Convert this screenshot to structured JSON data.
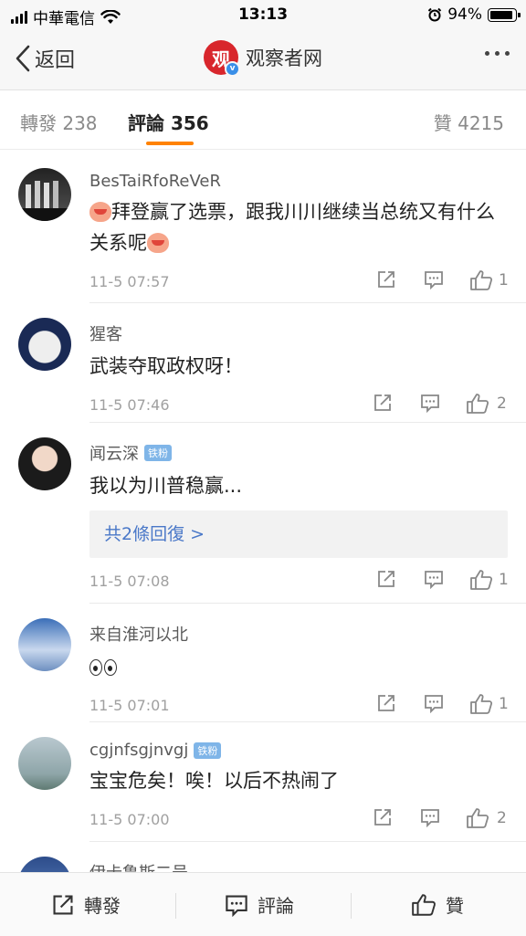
{
  "status_bar": {
    "carrier": "中華電信",
    "time": "13:13",
    "battery_percent": "94%",
    "battery_level": 0.94
  },
  "nav": {
    "back_label": "返回",
    "logo_text": "观",
    "title": "观察者网",
    "verified_mark": "v"
  },
  "tabs": {
    "repost": {
      "label": "轉發",
      "count": "238"
    },
    "comments": {
      "label": "評論",
      "count": "356"
    },
    "likes": {
      "label": "贊",
      "count": "4215"
    }
  },
  "colors": {
    "accent_orange": "#ff8200",
    "link_blue": "#4a78c8",
    "brand_red": "#d8262c"
  },
  "comments": [
    {
      "name": "BesTaiRfoReVeR",
      "text": "拜登赢了选票，跟我川川继续当总统又有什么关系呢",
      "time": "11-5 07:57",
      "likes": "1",
      "badge": "",
      "reply": ""
    },
    {
      "name": "猩客",
      "text": "武装夺取政权呀！",
      "time": "11-5 07:46",
      "likes": "2",
      "badge": "",
      "reply": ""
    },
    {
      "name": "闻云深",
      "text": "我以为川普稳赢...",
      "time": "11-5 07:08",
      "likes": "1",
      "badge": "铁粉",
      "reply": "共2條回復 >"
    },
    {
      "name": "来自淮河以北",
      "text": "",
      "time": "11-5 07:01",
      "likes": "1",
      "badge": "",
      "reply": ""
    },
    {
      "name": "cgjnfsgjnvgj",
      "text": "宝宝危矣！唉！以后不热闹了",
      "time": "11-5 07:00",
      "likes": "2",
      "badge": "铁粉",
      "reply": ""
    },
    {
      "name": "伊卡鲁斯二号"
    }
  ],
  "bottom_bar": {
    "repost_label": "轉發",
    "comment_label": "評論",
    "like_label": "贊"
  },
  "icons": [
    "signal-icon",
    "wifi-icon",
    "alarm-icon",
    "battery-icon",
    "back-chevron-icon",
    "more-icon",
    "share-icon",
    "comment-icon",
    "like-icon",
    "emoji-icon",
    "eyes-emoji-icon"
  ]
}
